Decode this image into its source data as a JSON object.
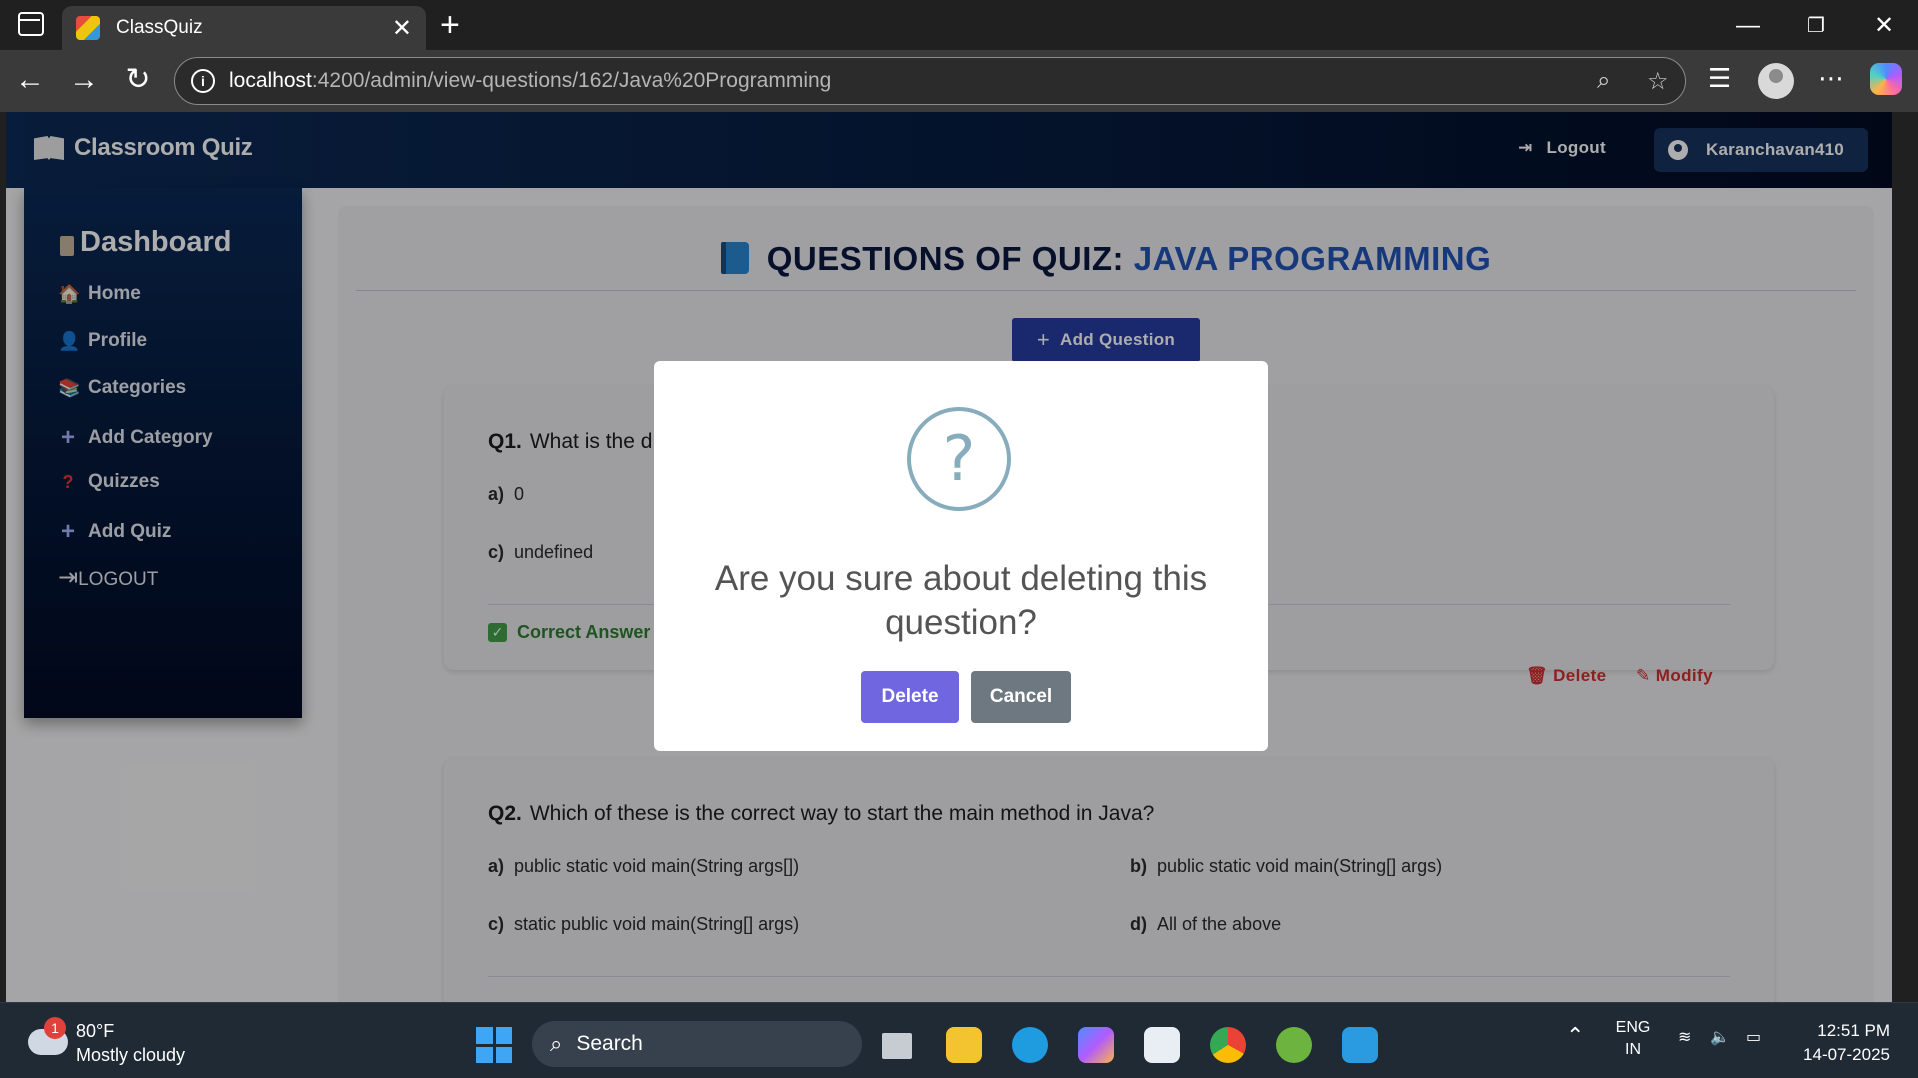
{
  "browser": {
    "tab_title": "ClassQuiz",
    "url_host": "localhost",
    "url_path": ":4200/admin/view-questions/162/Java%20Programming"
  },
  "app": {
    "brand": "Classroom Quiz",
    "logout_label": "Logout",
    "username": "Karanchavan410"
  },
  "sidebar": {
    "title": "Dashboard",
    "items": [
      {
        "label": "Home",
        "icon": "🏠"
      },
      {
        "label": "Profile",
        "icon": "👤"
      },
      {
        "label": "Categories",
        "icon": "📚"
      },
      {
        "label": "Add Category",
        "icon": "+"
      },
      {
        "label": "Quizzes",
        "icon": "?"
      },
      {
        "label": "Add Quiz",
        "icon": "+"
      }
    ],
    "logout_label": "LOGOUT"
  },
  "page": {
    "title_prefix": "QUESTIONS OF QUIZ:",
    "quiz_name": "JAVA PROGRAMMING",
    "add_question_label": "Add Question"
  },
  "questions": [
    {
      "number": "Q1.",
      "text": "What is the d",
      "options": [
        {
          "key": "a)",
          "text": "0"
        },
        {
          "key": "c)",
          "text": "undefined"
        }
      ],
      "answer_label": "Correct Answer",
      "delete_label": "Delete",
      "modify_label": "Modify"
    },
    {
      "number": "Q2.",
      "text": "Which of these is the correct way to start the main method in Java?",
      "options": [
        {
          "key": "a)",
          "text": "public static void main(String args[])"
        },
        {
          "key": "b)",
          "text": "public static void main(String[] args)"
        },
        {
          "key": "c)",
          "text": "static public void main(String[] args)"
        },
        {
          "key": "d)",
          "text": "All of the above"
        }
      ]
    }
  ],
  "modal": {
    "icon": "?",
    "title": "Are you sure about deleting this question?",
    "confirm_label": "Delete",
    "cancel_label": "Cancel"
  },
  "taskbar": {
    "weather_badge": "1",
    "temperature": "80°F",
    "condition": "Mostly cloudy",
    "search_label": "Search",
    "language": "ENG",
    "region": "IN",
    "time": "12:51 PM",
    "date": "14-07-2025"
  },
  "colors": {
    "nav_dark": "#061a3d",
    "accent_blue": "#273ba1",
    "delete_purple": "#7066e0",
    "cancel_gray": "#6e7881",
    "danger_red": "#d32f2f",
    "success_green": "#2e7d32"
  }
}
